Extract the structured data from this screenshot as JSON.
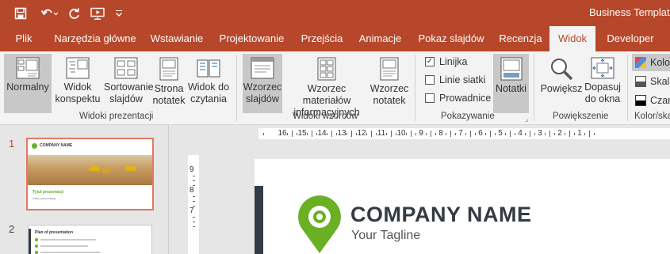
{
  "document": {
    "title": "Business Template v"
  },
  "quick_access": {
    "icons": [
      "save-icon",
      "undo-icon",
      "redo-icon",
      "present-from-start-icon",
      "customize-icon"
    ]
  },
  "tabs": [
    "Plik",
    "Narzędzia główne",
    "Wstawianie",
    "Projektowanie",
    "Przejścia",
    "Animacje",
    "Pokaz slajdów",
    "Recenzja",
    "Widok",
    "Developer"
  ],
  "active_tab": "Widok",
  "ribbon": {
    "views": {
      "group": "Widoki prezentacji",
      "normal": [
        "Normalny",
        ""
      ],
      "outline": [
        "Widok",
        "konspektu"
      ],
      "sorter": [
        "Sortowanie",
        "slajdów"
      ],
      "notes_page": [
        "Strona",
        "notatek"
      ],
      "reading": [
        "Widok do",
        "czytania"
      ]
    },
    "masters": {
      "group": "Widoki wzorców",
      "slide_master": [
        "Wzorzec",
        "slajdów"
      ],
      "handout_master": [
        "Wzorzec materiałów",
        "informacyjnych"
      ],
      "notes_master": [
        "Wzorzec",
        "notatek"
      ]
    },
    "show": {
      "group": "Pokazywanie",
      "ruler": "Linijka",
      "ruler_checked": true,
      "gridlines": "Linie siatki",
      "guides": "Prowadnice",
      "notes": "Notatki"
    },
    "zoom": {
      "group": "Powiększenie",
      "zoom": "Powiększ",
      "fit": [
        "Dopasuj",
        "do okna"
      ]
    },
    "color": {
      "group": "Kolor/ska",
      "color": "Kolo",
      "grayscale": "Skala",
      "bw": "Czar"
    }
  },
  "thumbnails": [
    {
      "number": "1",
      "company": "COMPANY NAME",
      "title": "Tytuł prezentacji",
      "subtitle": "Data prezentacji"
    },
    {
      "number": "2",
      "title": "Plan of presentation"
    }
  ],
  "ruler": {
    "labels": [
      "16",
      "15",
      "14",
      "13",
      "12",
      "11",
      "10",
      "9",
      "8",
      "7",
      "6",
      "5",
      "4",
      "3",
      "2",
      "1"
    ],
    "vlabels": [
      "9",
      "8",
      "7"
    ]
  },
  "slide": {
    "company": "COMPANY NAME",
    "tagline": "Your Tagline"
  },
  "colors": {
    "accent": "#b7472a",
    "brand_green": "#6ab023",
    "brand_dark": "#333b44",
    "selected": "#c8c8c8"
  }
}
